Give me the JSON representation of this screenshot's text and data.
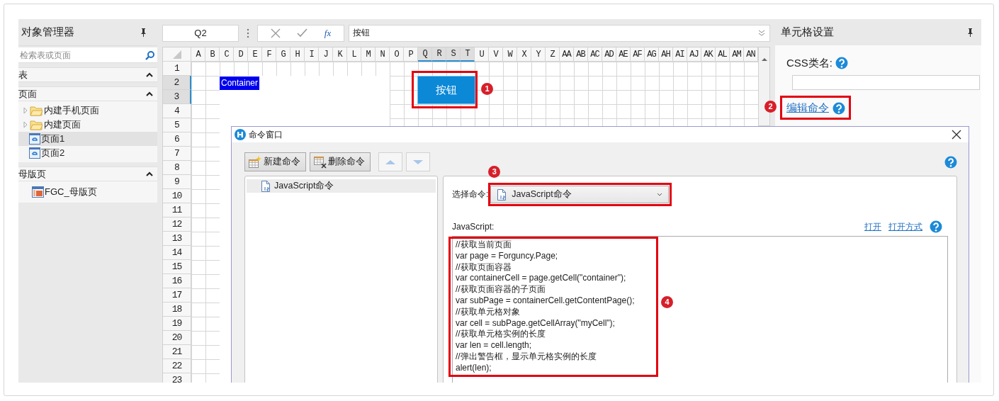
{
  "object_manager": {
    "title": "对象管理器",
    "search": {
      "placeholder": "检索表或页面"
    },
    "sections": [
      {
        "label": "表",
        "expanded": true
      },
      {
        "label": "页面",
        "expanded": true,
        "items": [
          {
            "label": "内建手机页面",
            "kind": "folder",
            "expanded": false,
            "selected": false
          },
          {
            "label": "内建页面",
            "kind": "folder",
            "expanded": false,
            "selected": false
          },
          {
            "label": "页面1",
            "kind": "page",
            "selected": true
          },
          {
            "label": "页面2",
            "kind": "page",
            "selected": false
          }
        ]
      },
      {
        "label": "母版页",
        "expanded": true,
        "items": [
          {
            "label": "FGC_母版页",
            "kind": "master",
            "selected": false
          }
        ]
      }
    ]
  },
  "formula_bar": {
    "cell_ref": "Q2",
    "function_label": "fx",
    "formula": "按钮"
  },
  "sheet": {
    "columns": [
      {
        "label": "A",
        "selected": false
      },
      {
        "label": "B",
        "selected": false
      },
      {
        "label": "C",
        "selected": false
      },
      {
        "label": "D",
        "selected": false
      },
      {
        "label": "E",
        "selected": false
      },
      {
        "label": "F",
        "selected": false
      },
      {
        "label": "G",
        "selected": false
      },
      {
        "label": "H",
        "selected": false
      },
      {
        "label": "I",
        "selected": false
      },
      {
        "label": "J",
        "selected": false
      },
      {
        "label": "K",
        "selected": false
      },
      {
        "label": "L",
        "selected": false
      },
      {
        "label": "M",
        "selected": false
      },
      {
        "label": "N",
        "selected": false
      },
      {
        "label": "O",
        "selected": false
      },
      {
        "label": "P",
        "selected": false
      },
      {
        "label": "Q",
        "selected": true
      },
      {
        "label": "R",
        "selected": true
      },
      {
        "label": "S",
        "selected": true
      },
      {
        "label": "T",
        "selected": true
      },
      {
        "label": "U",
        "selected": false
      },
      {
        "label": "V",
        "selected": false
      },
      {
        "label": "W",
        "selected": false
      },
      {
        "label": "X",
        "selected": false
      },
      {
        "label": "Y",
        "selected": false
      },
      {
        "label": "Z",
        "selected": false
      },
      {
        "label": "AA",
        "selected": false
      },
      {
        "label": "AB",
        "selected": false
      },
      {
        "label": "AC",
        "selected": false
      },
      {
        "label": "AD",
        "selected": false
      },
      {
        "label": "AE",
        "selected": false
      },
      {
        "label": "AF",
        "selected": false
      },
      {
        "label": "AG",
        "selected": false
      },
      {
        "label": "AH",
        "selected": false
      },
      {
        "label": "AI",
        "selected": false
      },
      {
        "label": "AJ",
        "selected": false
      },
      {
        "label": "AK",
        "selected": false
      },
      {
        "label": "AL",
        "selected": false
      },
      {
        "label": "AM",
        "selected": false
      },
      {
        "label": "AN",
        "selected": false
      }
    ],
    "rows": [
      {
        "label": "1",
        "selected": false
      },
      {
        "label": "2",
        "selected": true
      },
      {
        "label": "3",
        "selected": true
      },
      {
        "label": "4",
        "selected": false
      },
      {
        "label": "5",
        "selected": false
      },
      {
        "label": "6",
        "selected": false
      },
      {
        "label": "7",
        "selected": false
      },
      {
        "label": "8",
        "selected": false
      },
      {
        "label": "9",
        "selected": false
      },
      {
        "label": "10",
        "selected": false
      },
      {
        "label": "11",
        "selected": false
      },
      {
        "label": "12",
        "selected": false
      },
      {
        "label": "13",
        "selected": false
      },
      {
        "label": "14",
        "selected": false
      },
      {
        "label": "15",
        "selected": false
      },
      {
        "label": "16",
        "selected": false
      },
      {
        "label": "17",
        "selected": false
      },
      {
        "label": "18",
        "selected": false
      },
      {
        "label": "19",
        "selected": false
      },
      {
        "label": "20",
        "selected": false
      },
      {
        "label": "21",
        "selected": false
      },
      {
        "label": "22",
        "selected": false
      },
      {
        "label": "23",
        "selected": false
      }
    ],
    "container_cell": {
      "text": "Container"
    },
    "button_cell": {
      "text": "按钮",
      "callout": "1"
    }
  },
  "cell_settings": {
    "title": "单元格设置",
    "css_class_label": "CSS类名:",
    "edit_command_link": "编辑命令",
    "edit_command_callout": "2"
  },
  "command_window": {
    "title": "命令窗口",
    "toolbar": [
      {
        "kind": "new",
        "label": "新建命令",
        "disabled": false
      },
      {
        "kind": "delete",
        "label": "删除命令",
        "disabled": false
      },
      {
        "kind": "up",
        "disabled": true
      },
      {
        "kind": "down",
        "disabled": true
      }
    ],
    "commands": [
      {
        "label": "JavaScript命令",
        "selected": true
      }
    ],
    "select_label": "选择命令:",
    "selected_command": "JavaScript命令",
    "select_callout": "3",
    "script_label": "JavaScript:",
    "links": [
      "打开",
      "打开方式"
    ],
    "code": [
      "//获取当前页面",
      "var page = Forguncy.Page;",
      "//获取页面容器",
      "var containerCell = page.getCell(\"container\");",
      "//获取页面容器的子页面",
      "var subPage = containerCell.getContentPage();",
      "//获取单元格对象",
      "var cell = subPage.getCellArray(\"myCell\");",
      "//获取单元格实例的长度",
      "var len = cell.length;",
      "//弹出警告框，显示单元格实例的长度",
      "alert(len);"
    ],
    "code_callout": "4"
  }
}
